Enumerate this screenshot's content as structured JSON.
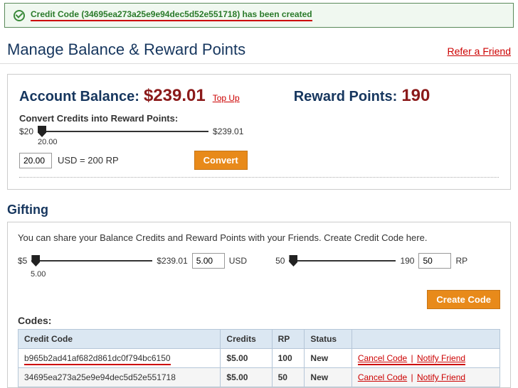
{
  "alert": {
    "text": "Credit Code (34695ea273a25e9e94dec5d52e551718) has been created"
  },
  "header": {
    "title": "Manage Balance & Reward Points",
    "refer": "Refer a Friend"
  },
  "balance": {
    "label": "Account Balance:",
    "amount": "$239.01",
    "topup": "Top Up",
    "rp_label": "Reward Points:",
    "rp_amount": "190",
    "convert_label": "Convert Credits into Reward Points:",
    "slider_min": "$20",
    "slider_max": "$239.01",
    "slider_sub": "20.00",
    "input_value": "20.00",
    "eq_text": "USD = 200 RP",
    "convert_btn": "Convert"
  },
  "gifting": {
    "heading": "Gifting",
    "intro": "You can share your Balance Credits and Reward Points with your Friends. Create Credit Code here.",
    "usd_min": "$5",
    "usd_max": "$239.01",
    "usd_sub": "5.00",
    "usd_val": "5.00",
    "usd_unit": "USD",
    "rp_min": "50",
    "rp_max": "190",
    "rp_val": "50",
    "rp_unit": "RP",
    "create_btn": "Create Code",
    "codes_h": "Codes:",
    "th_code": "Credit Code",
    "th_credits": "Credits",
    "th_rp": "RP",
    "th_status": "Status",
    "rows": [
      {
        "code": "b965b2ad41af682d861dc0f794bc6150",
        "credits": "$5.00",
        "rp": "100",
        "status": "New"
      },
      {
        "code": "34695ea273a25e9e94dec5d52e551718",
        "credits": "$5.00",
        "rp": "50",
        "status": "New"
      }
    ],
    "cancel": "Cancel Code",
    "notify": "Notify Friend"
  }
}
